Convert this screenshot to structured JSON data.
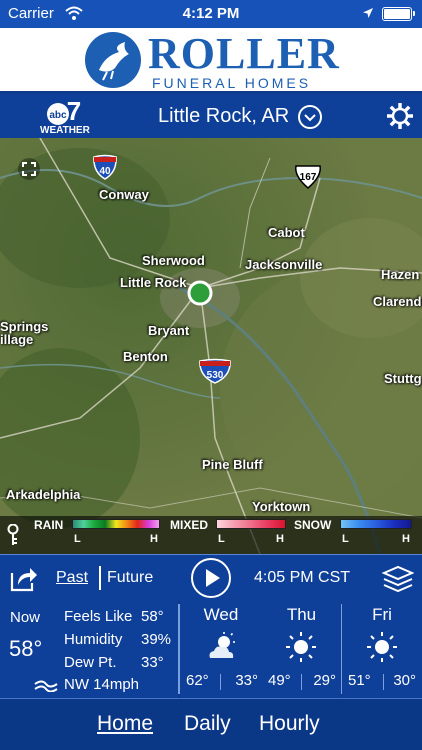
{
  "status_bar": {
    "carrier": "Carrier",
    "time": "4:12 PM"
  },
  "ad_banner": {
    "brand": "ROLLER",
    "subtitle": "FUNERAL HOMES"
  },
  "header": {
    "station_logo_text": "abc",
    "station_number": "7",
    "station_weather": "WEATHER",
    "location": "Little Rock, AR"
  },
  "map": {
    "labels": [
      "Conway",
      "Sherwood",
      "Cabot",
      "Jacksonville",
      "Little Rock",
      "Hazen",
      "Clarendo",
      "Springs",
      "illage",
      "Bryant",
      "Benton",
      "Stuttg",
      "Pine Bluff",
      "Arkadelphia",
      "Yorktown"
    ],
    "shields": {
      "i40": "40",
      "us167": "167",
      "i530": "530"
    }
  },
  "legend": {
    "rain": "RAIN",
    "mixed": "MIXED",
    "snow": "SNOW",
    "low": "L",
    "high": "H",
    "rain_colors": [
      "#2e8a76",
      "#4fd29a",
      "#19a83a",
      "#0d7a21",
      "#f3e61d",
      "#f28a16",
      "#e2261a",
      "#d73bd7",
      "#f3a0f0"
    ],
    "mixed_colors": [
      "#fbd6de",
      "#f59fb0",
      "#ef6f89",
      "#e73a5e",
      "#d8142e"
    ],
    "snow_colors": [
      "#74c3f4",
      "#3b8ef0",
      "#2a5fe0",
      "#1b2fc0",
      "#141a8f"
    ]
  },
  "controls": {
    "past": "Past",
    "future": "Future",
    "time": "4:05 PM CST"
  },
  "current": {
    "now_label": "Now",
    "temp": "58°",
    "feels_label": "Feels Like",
    "feels_value": "58°",
    "humidity_label": "Humidity",
    "humidity_value": "39%",
    "dew_label": "Dew Pt.",
    "dew_value": "33°",
    "wind": "NW 14mph"
  },
  "forecast": [
    {
      "day": "Wed",
      "icon": "partly-cloudy-icon",
      "hi": "62°",
      "lo": "33°"
    },
    {
      "day": "Thu",
      "icon": "sun-icon",
      "hi": "49°",
      "lo": "29°"
    },
    {
      "day": "Fri",
      "icon": "sun-icon",
      "hi": "51°",
      "lo": "30°"
    }
  ],
  "tabs": {
    "home": "Home",
    "daily": "Daily",
    "hourly": "Hourly"
  },
  "colors": {
    "app_blue": "#0e3f99",
    "status_blue": "#1752b8",
    "brand_blue": "#1d5fb3",
    "location_dot": "#2e9e3a"
  }
}
